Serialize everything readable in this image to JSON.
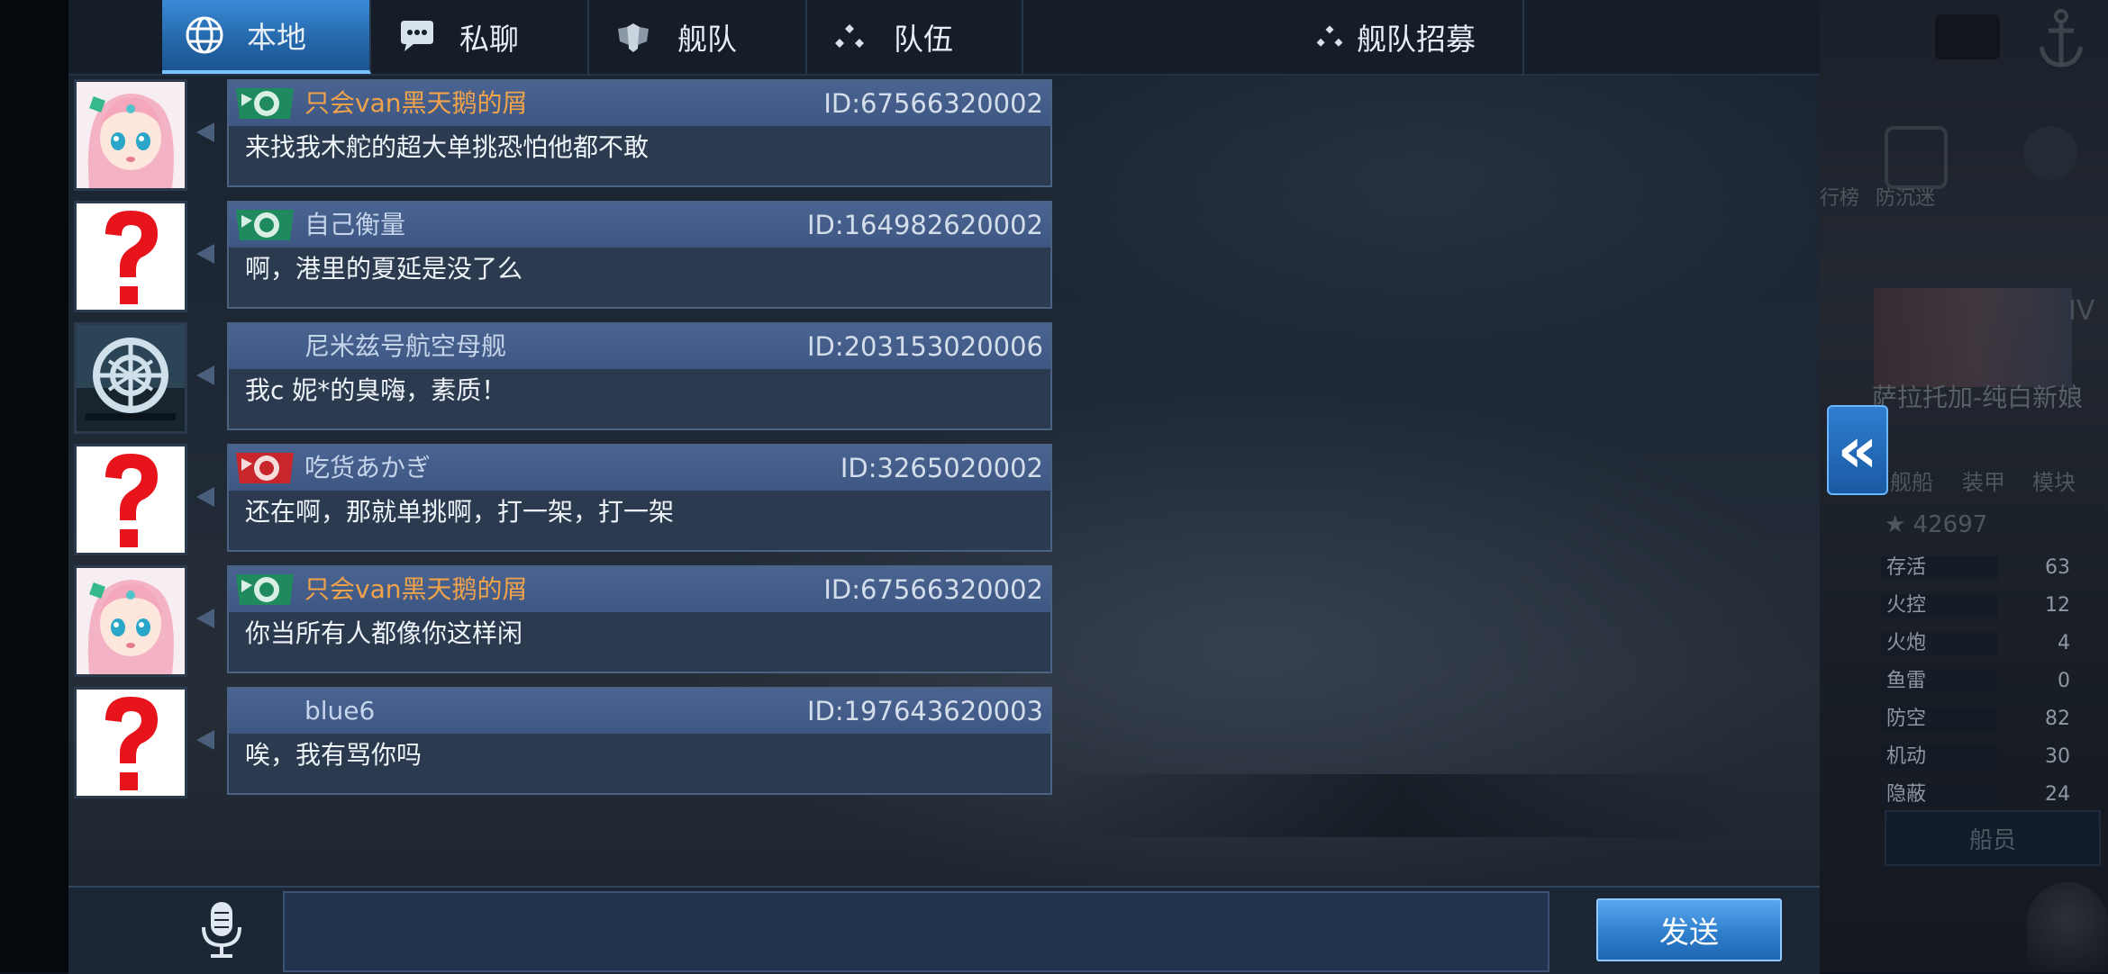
{
  "tabs": [
    {
      "label": "本地",
      "icon": "globe-icon",
      "active": true
    },
    {
      "label": "私聊",
      "icon": "chat-bubble-icon",
      "active": false
    },
    {
      "label": "舰队",
      "icon": "fleet-emblem-icon",
      "active": false
    },
    {
      "label": "队伍",
      "icon": "team-dots-icon",
      "active": false
    },
    {
      "label": "舰队招募",
      "icon": "team-dots-icon",
      "active": false
    }
  ],
  "messages": [
    {
      "sender": "只会van黑天鹅的屑",
      "id": "ID:67566320002",
      "text": "来找我木舵的超大单挑恐怕他都不敢",
      "avatar": "pink-hair-girl-avatar",
      "badge": "green-fleet-badge"
    },
    {
      "sender": "自己衡量",
      "id": "ID:164982620002",
      "text": "啊，港里的夏延是没了么",
      "avatar": "unknown-question-avatar",
      "badge": "green-fleet-badge"
    },
    {
      "sender": "尼米兹号航空母舰",
      "id": "ID:203153020006",
      "text": "我c 妮*的臭嗨，素质！",
      "avatar": "carrier-crosshair-avatar",
      "badge": ""
    },
    {
      "sender": "吃货あかぎ",
      "id": "ID:3265020002",
      "text": "还在啊，那就单挑啊，打一架，打一架",
      "avatar": "unknown-question-avatar",
      "badge": "red-fleet-badge"
    },
    {
      "sender": "只会van黑天鹅的屑",
      "id": "ID:67566320002",
      "text": "你当所有人都像你这样闲",
      "avatar": "pink-hair-girl-avatar",
      "badge": "green-fleet-badge"
    },
    {
      "sender": "blue6",
      "id": "ID:197643620003",
      "text": "唉，我有骂你吗",
      "avatar": "unknown-question-avatar",
      "badge": ""
    }
  ],
  "input": {
    "value": "",
    "placeholder": ""
  },
  "send_label": "发送",
  "background_game": {
    "ship_name": "萨拉托加-纯白新娘",
    "tier": "IV",
    "score": "42697",
    "sub_tabs": [
      "舰船",
      "装甲",
      "模块"
    ],
    "side_labels": [
      "防沉迷",
      "行榜"
    ],
    "crew_button": "船员",
    "stats": [
      {
        "label": "存活",
        "value": "63"
      },
      {
        "label": "火控",
        "value": "12"
      },
      {
        "label": "火炮",
        "value": "4"
      },
      {
        "label": "鱼雷",
        "value": "0"
      },
      {
        "label": "防空",
        "value": "82"
      },
      {
        "label": "机动",
        "value": "30"
      },
      {
        "label": "隐蔽",
        "value": "24"
      }
    ]
  },
  "colors": {
    "tab_active": "#2f78c4",
    "bubble_header": "#445d8a",
    "bubble_body": "#2b3a4e",
    "sender_highlight": "#f0a34a",
    "send_button": "#3a8ad8"
  }
}
